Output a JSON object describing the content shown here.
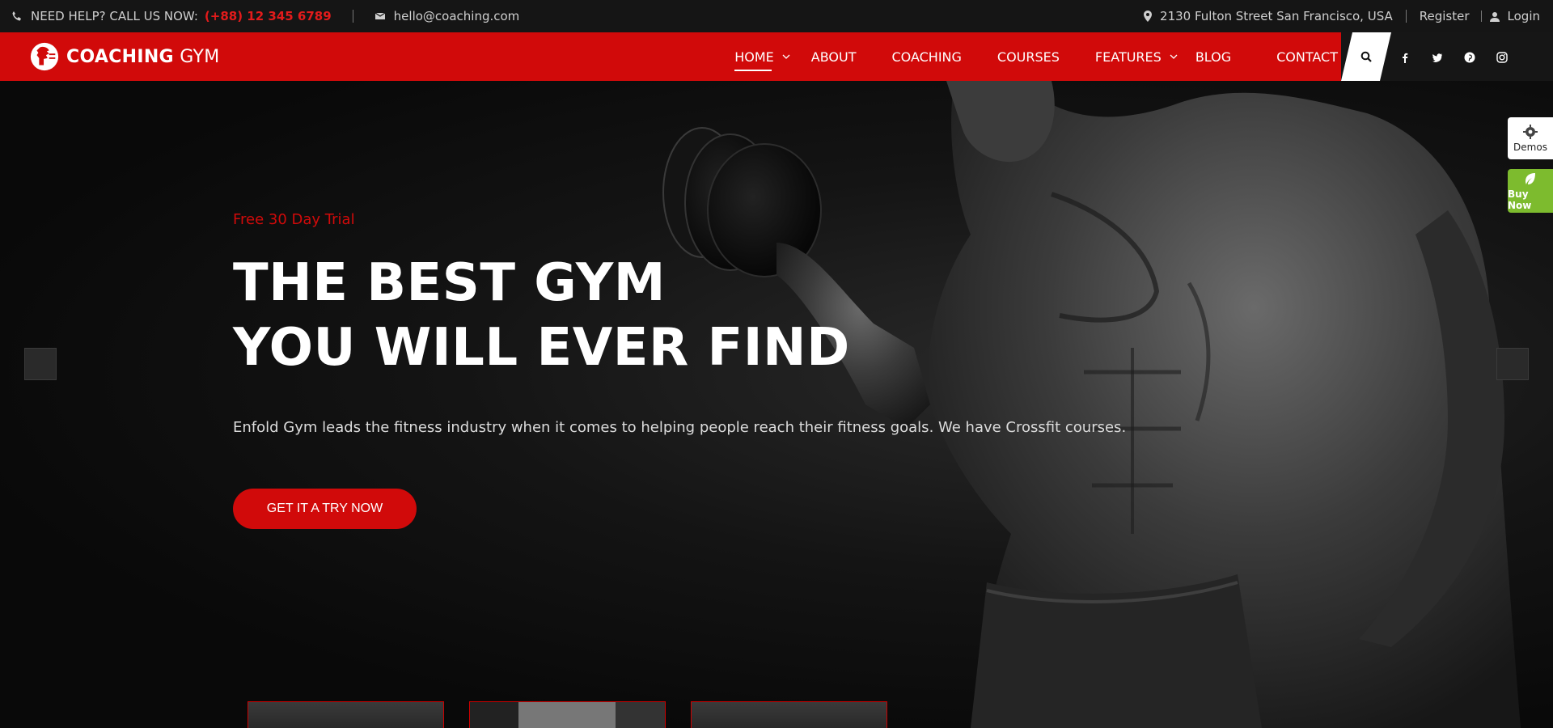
{
  "topbar": {
    "help_label": "NEED HELP? CALL US NOW:",
    "phone": "(+88) 12 345 6789",
    "email": "hello@coaching.com",
    "address": "2130 Fulton Street San Francisco, USA",
    "register": "Register",
    "login": "Login"
  },
  "brand": {
    "bold": "COACHING",
    "light": "GYM"
  },
  "menu": [
    "HOME",
    "ABOUT",
    "COACHING",
    "COURSES",
    "FEATURES",
    "BLOG",
    "CONTACT"
  ],
  "hero": {
    "kicker": "Free 30 Day Trial",
    "headline_line1": "THE BEST GYM",
    "headline_line2": "YOU WILL EVER FIND",
    "description": "Enfold Gym leads the fitness industry when it comes to helping people reach their fitness goals. We have Crossfit courses.",
    "cta": "GET IT A TRY NOW"
  },
  "side": {
    "demos": "Demos",
    "buy": "Buy Now"
  },
  "colors": {
    "accent": "#d10a0a",
    "dark": "#151515",
    "buy": "#7dbb2e"
  }
}
